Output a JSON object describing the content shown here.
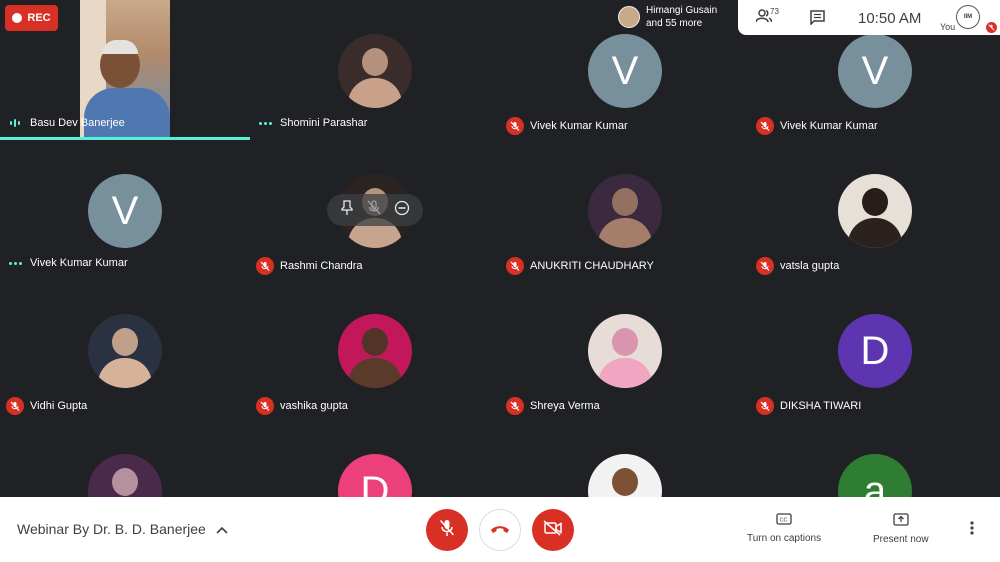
{
  "recording": {
    "label": "REC",
    "color": "#d93025"
  },
  "presenter": {
    "line1": "Himangi Gusain",
    "line2": "and 55 more"
  },
  "topbar": {
    "people_icon": "people-icon",
    "people_count": "73",
    "chat_icon": "chat-icon",
    "time": "10:50 AM",
    "you_label": "You",
    "you_avatar_text": "IIM"
  },
  "hover_controls": {
    "pin_icon": "pin-icon",
    "mute_icon": "mic-off-icon",
    "remove_icon": "remove-icon"
  },
  "participants": [
    {
      "name": "Basu Dev Banerjee",
      "status": "speaking",
      "type": "video",
      "active": true
    },
    {
      "name": "Shomini Parashar",
      "status": "dots",
      "type": "photo",
      "photo_colors": [
        "#3a2c2a",
        "#c9a08a"
      ]
    },
    {
      "name": "Vivek Kumar Kumar",
      "status": "muted",
      "type": "letter",
      "letter": "V",
      "bg": "#78909c"
    },
    {
      "name": "Vivek Kumar Kumar",
      "status": "muted",
      "type": "letter",
      "letter": "V",
      "bg": "#78909c"
    },
    {
      "name": "Vivek Kumar Kumar",
      "status": "dots",
      "type": "letter",
      "letter": "V",
      "bg": "#78909c"
    },
    {
      "name": "Rashmi Chandra",
      "status": "muted",
      "type": "photo",
      "photo_colors": [
        "#2a2320",
        "#c7a48e"
      ]
    },
    {
      "name": "ANUKRITI CHAUDHARY",
      "status": "muted",
      "type": "photo",
      "photo_colors": [
        "#3b2a3f",
        "#a57d6b"
      ]
    },
    {
      "name": "vatsla gupta",
      "status": "muted",
      "type": "photo",
      "photo_colors": [
        "#e6e0d8",
        "#2b211d"
      ]
    },
    {
      "name": "Vidhi Gupta",
      "status": "muted",
      "type": "photo",
      "photo_colors": [
        "#2a3140",
        "#d6b29a"
      ]
    },
    {
      "name": "vashika gupta",
      "status": "muted",
      "type": "photo",
      "photo_colors": [
        "#c2185b",
        "#5a3a2a"
      ]
    },
    {
      "name": "Shreya Verma",
      "status": "muted",
      "type": "photo",
      "photo_colors": [
        "#e8dcd8",
        "#f0a6c0"
      ]
    },
    {
      "name": "DIKSHA TIWARI",
      "status": "muted",
      "type": "letter",
      "letter": "D",
      "bg": "#5e35b1"
    },
    {
      "name": "",
      "status": "none",
      "type": "photo",
      "photo_colors": [
        "#4a2a4a",
        "#c9a0b0"
      ]
    },
    {
      "name": "",
      "status": "none",
      "type": "letter",
      "letter": "D",
      "bg": "#ec407a"
    },
    {
      "name": "",
      "status": "none",
      "type": "photo",
      "photo_colors": [
        "#f2f2f2",
        "#8a5a3a"
      ]
    },
    {
      "name": "",
      "status": "none",
      "type": "letter",
      "letter": "a",
      "bg": "#2e7d32"
    }
  ],
  "bottombar": {
    "meeting_title": "Webinar By Dr. B. D. Banerjee",
    "captions_label": "Turn on captions",
    "present_label": "Present now",
    "mic_icon": "mic-off-icon",
    "hangup_icon": "hang-up-icon",
    "camera_icon": "camera-off-icon",
    "more_icon": "more-vert-icon"
  }
}
